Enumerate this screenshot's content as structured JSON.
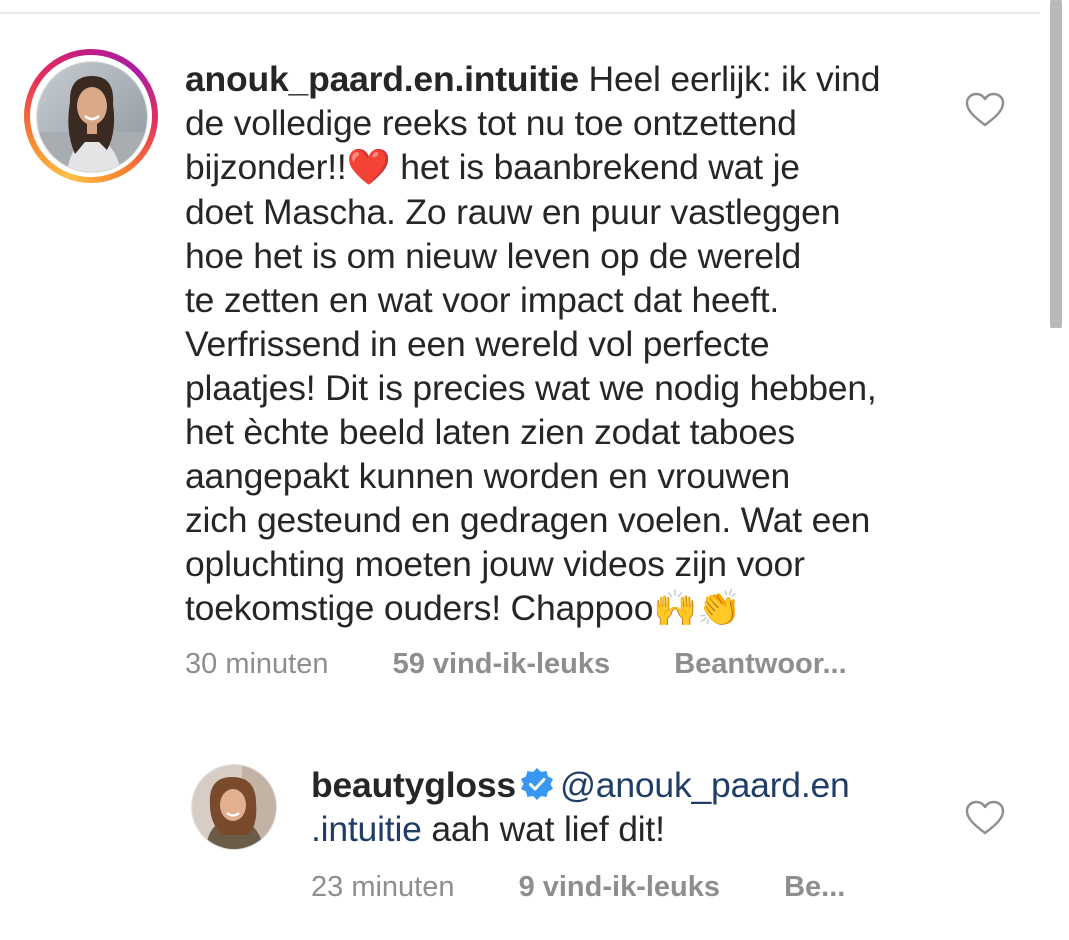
{
  "comments": [
    {
      "username": "anouk_paard.en.intuitie",
      "text_lines": [
        " Heel eerlijk: ik vind",
        "de volledige reeks tot nu toe ontzettend",
        "bijzonder!!",
        " het is baanbrekend wat je",
        "doet Mascha. Zo rauw en puur vastleggen",
        "hoe het is om nieuw leven op de wereld",
        "te zetten en wat voor impact dat heeft.",
        "Verfrissend in een wereld vol perfecte",
        "plaatjes! Dit is precies wat we nodig hebben,",
        "het èchte beeld laten zien zodat taboes",
        "aangepakt kunnen worden en vrouwen",
        "zich gesteund en gedragen voelen. Wat een",
        "opluchting moeten jouw videos zijn voor",
        "toekomstige ouders! Chappoo"
      ],
      "heart_emoji": "❤️",
      "end_emojis": "🙌👏",
      "time": "30 minuten",
      "likes": "59 vind-ik-leuks",
      "reply": "Beantwoor...",
      "has_story_ring": true
    },
    {
      "username": "beautygloss",
      "verified": true,
      "mention_part1": "@anouk_paard.en",
      "mention_part2": ".intuitie",
      "text_rest": " aah wat lief dit!",
      "time": "23 minuten",
      "likes": "9 vind-ik-leuks",
      "reply": "Be..."
    }
  ],
  "icons": {
    "like": "heart-outline-icon",
    "verified": "verified-badge-icon"
  },
  "colors": {
    "text": "#262626",
    "meta": "#8e8e8e",
    "mention": "#1f3d67",
    "verified": "#3897f0"
  }
}
